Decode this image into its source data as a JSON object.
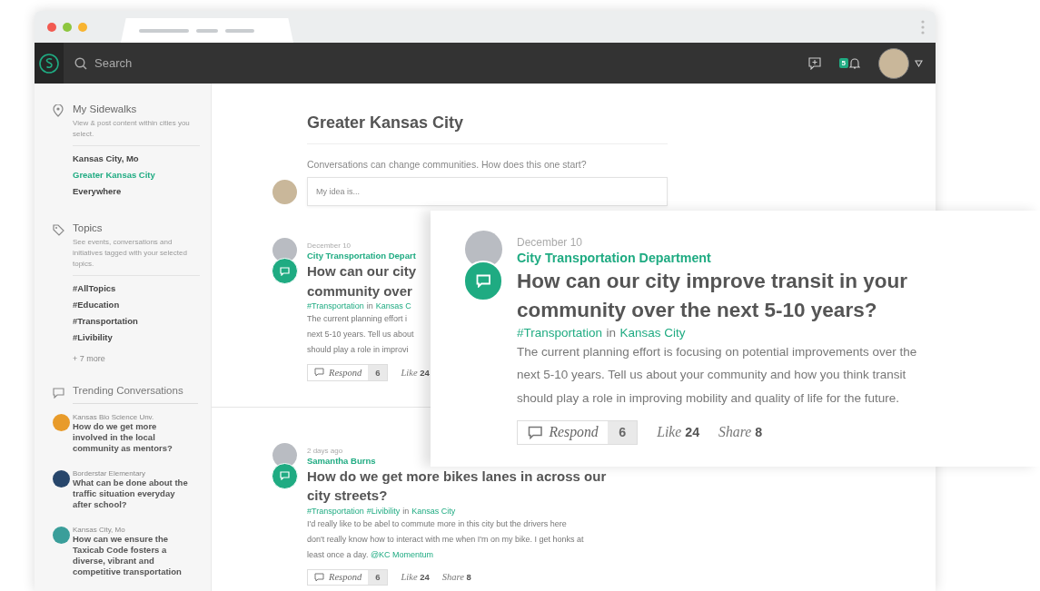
{
  "top_bar": {
    "search": {
      "placeholder": "Search"
    },
    "notification_count": "5"
  },
  "sidebar": {
    "sections": [
      {
        "kind": "places",
        "title": "My Sidewalks",
        "description": "View & post content within cities you select.",
        "items": [
          {
            "label": "Kansas City, Mo",
            "selected": false
          },
          {
            "label": "Greater Kansas City",
            "selected": true
          },
          {
            "label": "Everywhere",
            "selected": false
          }
        ]
      },
      {
        "kind": "topics",
        "title": "Topics",
        "description": "See events, conversations and initiatives tagged with your selected topics.",
        "items": [
          {
            "label": "#AllTopics"
          },
          {
            "label": "#Education"
          },
          {
            "label": "#Transportation"
          },
          {
            "label": "#Livibility"
          }
        ],
        "more": "+ 7 more"
      },
      {
        "kind": "trending",
        "title": "Trending Conversations",
        "conversations": [
          {
            "org": "Kansas Bio Science Unv.",
            "title": "How do we get more involved in the local community as mentors?",
            "color": "#e89b2a"
          },
          {
            "org": "Borderstar Elementary",
            "title": "What can be done about the traffic situation everyday after school?",
            "color": "#27466b"
          },
          {
            "org": "Kansas City, Mo",
            "title": "How can we ensure the Taxicab Code fosters a diverse, vibrant and competitive transportation",
            "color": "#3a9e9a"
          }
        ]
      }
    ]
  },
  "main": {
    "title": "Greater Kansas City",
    "prompt": "Conversations can change communities. How does this one start?",
    "composer": {
      "placeholder": "My idea is..."
    },
    "posts": [
      {
        "date": "December 10",
        "author": "City Transportation Depart",
        "title_lines": [
          "How can our city",
          "community over"
        ],
        "tags": [
          {
            "kind": "topic",
            "text": "#Transportation"
          },
          {
            "kind": "plain",
            "text": "in"
          },
          {
            "kind": "place",
            "text": "Kansas C"
          }
        ],
        "body_lines": [
          {
            "text": "The current planning effort i"
          },
          {
            "text": "next 5-10 years. Tell us about"
          },
          {
            "text": "should play a role in improvi"
          }
        ],
        "actions": {
          "respond": "Respond",
          "respond_count": "6",
          "like": "Like",
          "like_count": "24"
        }
      },
      {
        "date": "2 days ago",
        "author": "Samantha Burns",
        "title_lines": [
          "How do we get more bikes lanes in across our",
          "city streets?"
        ],
        "tags": [
          {
            "kind": "topic",
            "text": "#Transportation"
          },
          {
            "kind": "topic",
            "text": "#Livibility"
          },
          {
            "kind": "plain",
            "text": "in"
          },
          {
            "kind": "place",
            "text": "Kansas City"
          }
        ],
        "body_lines": [
          {
            "text": "I'd really like to be abel to commute more in this city but the drivers here"
          },
          {
            "text": "don't really know how to interact with me when I'm on my bike. I get honks at"
          },
          {
            "text": "least once a day.",
            "mention": "@KC Momentum"
          }
        ],
        "actions": {
          "respond": "Respond",
          "respond_count": "6",
          "like": "Like",
          "like_count": "24",
          "share": "Share",
          "share_count": "8"
        }
      }
    ]
  },
  "featured_post": {
    "date": "December 10",
    "author": "City Transportation Department",
    "title_lines": [
      "How can our city improve transit in your",
      "community over the next 5-10 years?"
    ],
    "tags": [
      {
        "kind": "topic",
        "text": "#Transportation"
      },
      {
        "kind": "plain",
        "text": "in"
      },
      {
        "kind": "place",
        "text": "Kansas City"
      }
    ],
    "body_lines": [
      {
        "text": "The current planning effort is focusing on potential improvements over the"
      },
      {
        "text": "next 5-10 years. Tell us about your community and how you think transit"
      },
      {
        "text": "should play a role in improving mobility and quality of life for the future."
      }
    ],
    "actions": {
      "respond": "Respond",
      "respond_count": "6",
      "like": "Like",
      "like_count": "24",
      "share": "Share",
      "share_count": "8"
    }
  }
}
